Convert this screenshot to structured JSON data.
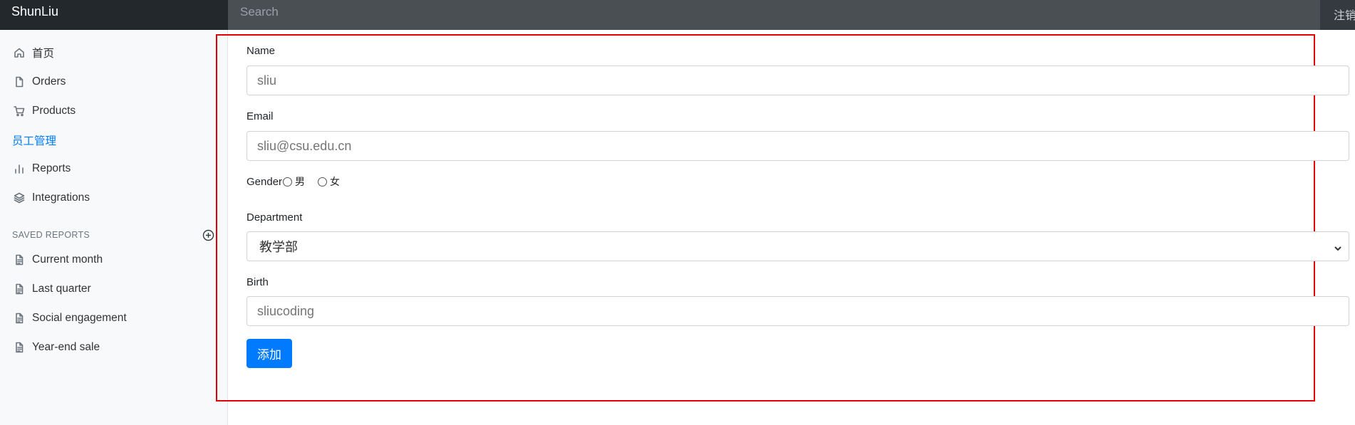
{
  "navbar": {
    "brand": "ShunLiu",
    "search_placeholder": "Search",
    "signout_label": "注销"
  },
  "sidebar": {
    "items": [
      {
        "label": "首页",
        "icon": "home-icon"
      },
      {
        "label": "Orders",
        "icon": "file-icon"
      },
      {
        "label": "Products",
        "icon": "shopping-cart-icon"
      },
      {
        "label": "员工管理",
        "icon": ""
      },
      {
        "label": "Reports",
        "icon": "bar-chart-icon"
      },
      {
        "label": "Integrations",
        "icon": "layers-icon"
      }
    ],
    "saved_reports_heading": "SAVED REPORTS",
    "saved_reports": [
      {
        "label": "Current month",
        "icon": "file-text-icon"
      },
      {
        "label": "Last quarter",
        "icon": "file-text-icon"
      },
      {
        "label": "Social engagement",
        "icon": "file-text-icon"
      },
      {
        "label": "Year-end sale",
        "icon": "file-text-icon"
      }
    ]
  },
  "form": {
    "name_label": "Name",
    "name_placeholder": "sliu",
    "email_label": "Email",
    "email_placeholder": "sliu@csu.edu.cn",
    "gender_label": "Gender",
    "gender_options": [
      "男",
      "女"
    ],
    "department_label": "Department",
    "department_value": "教学部",
    "birth_label": "Birth",
    "birth_placeholder": "sliucoding",
    "submit_label": "添加"
  },
  "colors": {
    "navbar": "#343a40",
    "brand_bg": "#23282d",
    "accent": "#007bff",
    "highlight_border": "#e30000"
  }
}
